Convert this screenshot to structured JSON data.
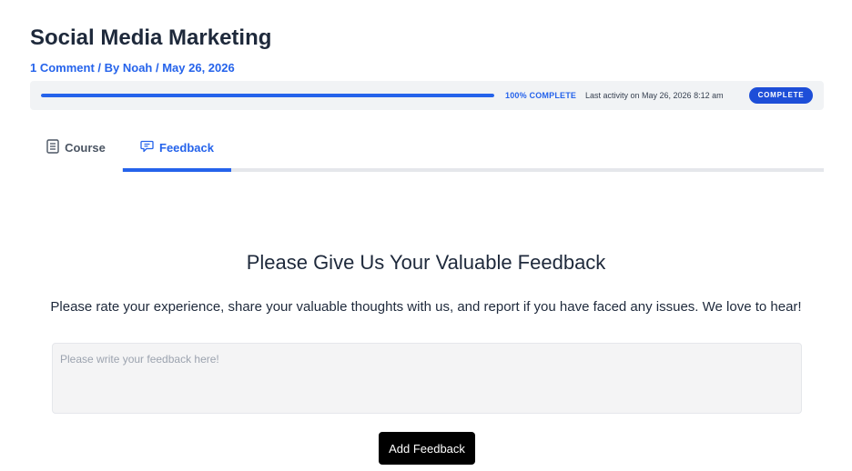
{
  "page": {
    "title": "Social Media Marketing",
    "meta": {
      "comments": "1 Comment",
      "sep1": " / ",
      "author": "By Noah",
      "sep2": " / ",
      "date": "May 26, 2026"
    }
  },
  "progress": {
    "percent": 100,
    "percent_label": "100% COMPLETE",
    "last_activity": "Last activity on May 26, 2026 8:12 am",
    "badge": "COMPLETE",
    "accent_color": "#2563eb"
  },
  "tabs": [
    {
      "label": "Course",
      "icon": "document-icon",
      "active": false
    },
    {
      "label": "Feedback",
      "icon": "chat-icon",
      "active": true
    }
  ],
  "feedback": {
    "heading": "Please Give Us Your Valuable Feedback",
    "subtitle": "Please rate your experience, share your valuable thoughts with us, and report if you have faced any issues. We love to hear!",
    "placeholder": "Please write your feedback here!",
    "value": "",
    "button_label": "Add Feedback"
  }
}
